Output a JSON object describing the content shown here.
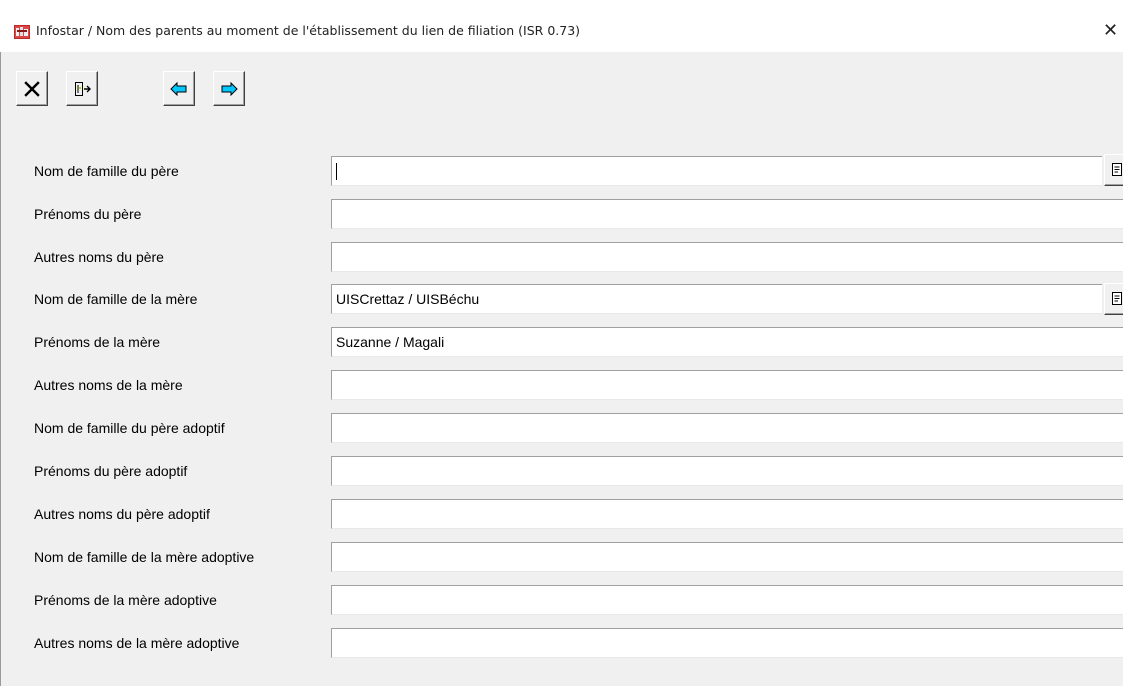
{
  "window": {
    "title": "Infostar / Nom des parents au moment de l'établissement du lien de filiation (ISR 0.73)",
    "close_glyph": "✕",
    "app_icon": "infostar-app-icon"
  },
  "toolbar": {
    "buttons": [
      {
        "name": "close",
        "icon": "x-icon"
      },
      {
        "name": "exit",
        "icon": "door-exit-icon"
      },
      {
        "name": "previous",
        "icon": "arrow-left-icon"
      },
      {
        "name": "next",
        "icon": "arrow-right-icon"
      }
    ],
    "arrow_color": "#00c8ff"
  },
  "form": {
    "rows": [
      {
        "label": "Nom de famille du père",
        "value": "",
        "lookup": true,
        "focused": true
      },
      {
        "label": "Prénoms du père",
        "value": ""
      },
      {
        "label": "Autres noms du père",
        "value": ""
      },
      {
        "label": "Nom de famille de la mère",
        "value": "UISCrettaz / UISBéchu",
        "lookup": true
      },
      {
        "label": "Prénoms de la mère",
        "value": "Suzanne / Magali"
      },
      {
        "label": "Autres noms de la mère",
        "value": ""
      },
      {
        "label": "Nom de famille du père adoptif",
        "value": ""
      },
      {
        "label": "Prénoms du père adoptif",
        "value": ""
      },
      {
        "label": "Autres noms du père adoptif",
        "value": ""
      },
      {
        "label": "Nom de famille de la mère adoptive",
        "value": ""
      },
      {
        "label": "Prénoms de la mère adoptive",
        "value": ""
      },
      {
        "label": "Autres noms de la mère adoptive",
        "value": ""
      }
    ]
  }
}
